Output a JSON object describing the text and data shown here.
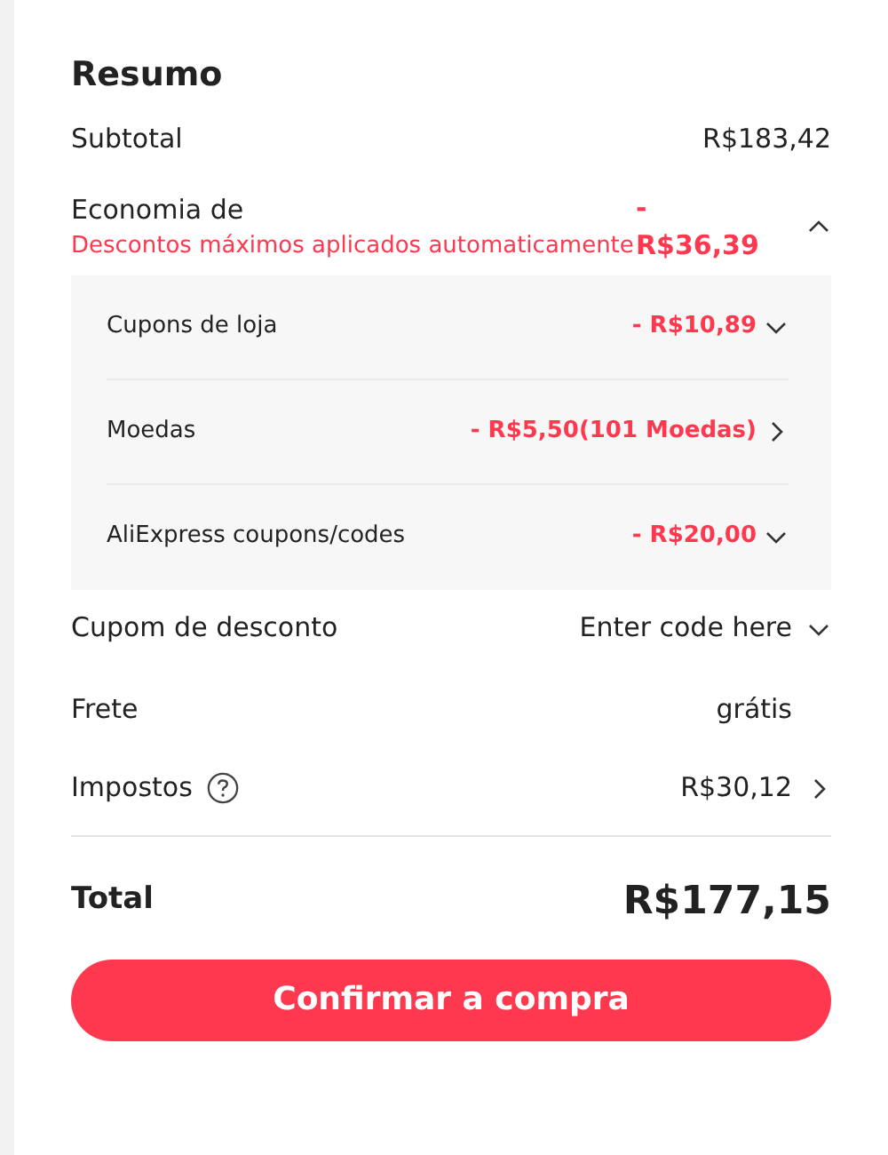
{
  "title": "Resumo",
  "subtotal": {
    "label": "Subtotal",
    "value": "R$183,42"
  },
  "savings": {
    "label": "Economia de",
    "note": "Descontos máximos aplicados automaticamente",
    "value": "- R$36,39",
    "expanded": true,
    "items": [
      {
        "label": "Cupons de loja",
        "value": "- R$10,89",
        "kind": "dropdown"
      },
      {
        "label": "Moedas",
        "value": "- R$5,50(101 Moedas)",
        "kind": "link"
      },
      {
        "label": "AliExpress coupons/codes",
        "value": "- R$20,00",
        "kind": "dropdown"
      }
    ]
  },
  "coupon": {
    "label": "Cupom de desconto",
    "value": "Enter code here",
    "kind": "dropdown"
  },
  "shipping": {
    "label": "Frete",
    "value": "grátis"
  },
  "taxes": {
    "label": "Impostos",
    "value": "R$30,12",
    "kind": "link"
  },
  "total": {
    "label": "Total",
    "value": "R$177,15"
  },
  "button": "Confirmar a compra"
}
